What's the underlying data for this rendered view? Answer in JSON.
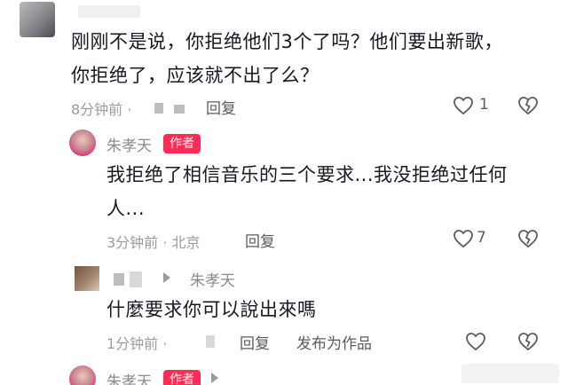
{
  "comments": [
    {
      "text_line1": "刚刚不是说，你拒绝他们3个了吗？他们要出新歌，",
      "text_line2": "你拒绝了，应该就不出了么？",
      "time": "8分钟前 ·",
      "reply_label": "回复",
      "like_count": "1"
    },
    {
      "username": "朱孝天",
      "badge": "作者",
      "text_line1": "我拒绝了相信音乐的三个要求...我没拒绝过任何",
      "text_line2": "人...",
      "time": "3分钟前 · 北京",
      "reply_label": "回复",
      "like_count": "7"
    },
    {
      "username": "朱孝天",
      "text_line1": "什麼要求你可以說出來嗎",
      "time": "1分钟前 ·",
      "reply_label": "回复",
      "publish_label": "发布为作品"
    },
    {
      "username": "朱孝天",
      "badge": "作者"
    }
  ],
  "colors": {
    "badge": "#fe2c55",
    "meta": "#9a9ba1"
  }
}
